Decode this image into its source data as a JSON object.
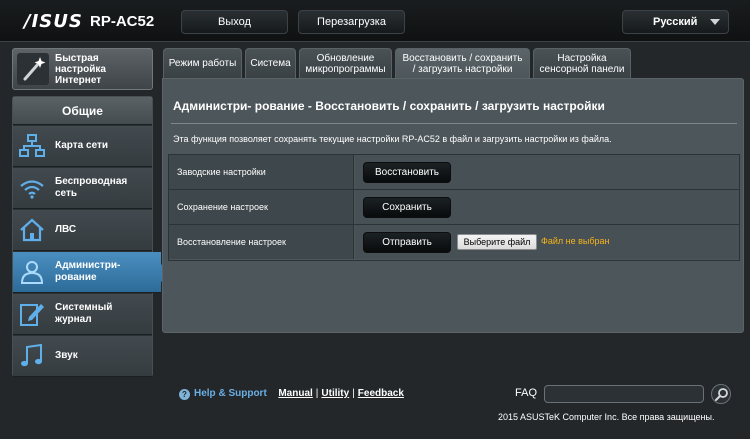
{
  "topbar": {
    "logo": "/ISUS",
    "model": "RP-AC52",
    "logout": "Выход",
    "reboot": "Перезагрузка",
    "language": "Русский"
  },
  "sidebar": {
    "quick_setup": "Быстрая настройка Интернет",
    "section": "Общие",
    "items": [
      {
        "label": "Карта сети",
        "icon": "network-map-icon"
      },
      {
        "label": "Беспроводная сеть",
        "icon": "wireless-icon"
      },
      {
        "label": "ЛВС",
        "icon": "lan-home-icon"
      },
      {
        "label": "Администри- рование",
        "icon": "administration-icon"
      },
      {
        "label": "Системный журнал",
        "icon": "system-log-icon"
      },
      {
        "label": "Звук",
        "icon": "music-icon"
      }
    ],
    "active_index": 3
  },
  "tabs": [
    "Режим работы",
    "Система",
    "Обновление микропрограммы",
    "Восстановить / сохранить / загрузить настройки",
    "Настройка сенсорной панели"
  ],
  "active_tab": 3,
  "panel": {
    "title": "Администри- рование - Восстановить / сохранить / загрузить настройки",
    "description": "Эта функция позволяет сохранять текущие настройки RP-AC52 в файл и загрузить настройки из файла.",
    "rows": [
      {
        "label": "Заводские настройки",
        "button": "Восстановить"
      },
      {
        "label": "Сохранение настроек",
        "button": "Сохранить"
      },
      {
        "label": "Восстановление настроек",
        "button": "Отправить",
        "file_button": "Выберите файл",
        "file_status": "Файл не выбран"
      }
    ]
  },
  "footer": {
    "help": "Help & Support",
    "links": [
      "Manual",
      "Utility",
      "Feedback"
    ],
    "faq": "FAQ",
    "copyright": "2015 ASUSTeK Computer Inc. Все права защищены."
  },
  "colors": {
    "accent_active": "#3a7cae",
    "file_status": "#f5b31c",
    "help_link": "#6ab0e4"
  }
}
